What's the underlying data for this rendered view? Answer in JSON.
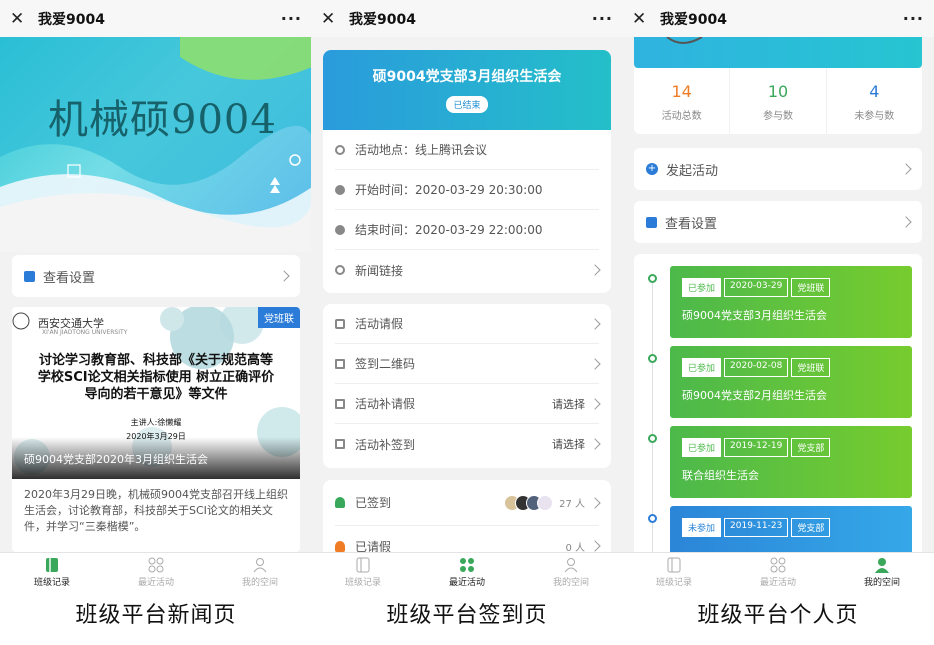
{
  "app_title": "我爱9004",
  "tabs": [
    "班级记录",
    "最近活动",
    "我的空间"
  ],
  "panel1": {
    "hero_title": "机械硕9004",
    "view_settings": "查看设置",
    "news": {
      "tag": "党班联",
      "university": "西安交通大学",
      "university_en": "XI'AN JIAOTONG UNIVERSITY",
      "headline_lines": [
        "讨论学习教育部、科技部《关于规范高等",
        "学校SCI论文相关指标使用 树立正确评价",
        "导向的若干意见》等文件"
      ],
      "speaker": "主讲人:徐懒耀",
      "date": "2020年3月29日",
      "caption": "硕9004党支部2020年3月组织生活会",
      "summary": "2020年3月29日晚，机械硕9004党支部召开线上组织生活会，讨论教育部，科技部关于SCI论文的相关文件，并学习“三秦楷模”。"
    },
    "caption": "班级平台新闻页"
  },
  "panel2": {
    "event_title": "硕9004党支部3月组织生活会",
    "status": "已结束",
    "location_label": "活动地点：",
    "location": "线上腾讯会议",
    "start_label": "开始时间：",
    "start": "2020-03-29 20:30:00",
    "end_label": "结束时间：",
    "end": "2020-03-29 22:00:00",
    "news_link": "新闻链接",
    "menu": [
      {
        "label": "活动请假",
        "option": ""
      },
      {
        "label": "签到二维码",
        "option": ""
      },
      {
        "label": "活动补请假",
        "option": "请选择"
      },
      {
        "label": "活动补签到",
        "option": "请选择"
      }
    ],
    "signed_label": "已签到",
    "signed_count": "27 人",
    "leave_label": "已请假",
    "leave_count": "0 人",
    "caption": "班级平台签到页"
  },
  "panel3": {
    "stats": [
      {
        "num": "14",
        "label": "活动总数",
        "color": "#f07c25"
      },
      {
        "num": "10",
        "label": "参与数",
        "color": "#3aa85a"
      },
      {
        "num": "4",
        "label": "未参与数",
        "color": "#2b7cd9"
      }
    ],
    "launch": "发起活动",
    "view_settings": "查看设置",
    "timeline": [
      {
        "status": "已参加",
        "date": "2020-03-29",
        "org": "党班联",
        "name": "硕9004党支部3月组织生活会"
      },
      {
        "status": "已参加",
        "date": "2020-02-08",
        "org": "党班联",
        "name": "硕9004党支部2月组织生活会"
      },
      {
        "status": "已参加",
        "date": "2019-12-19",
        "org": "党支部",
        "name": "联合组织生活会"
      },
      {
        "status": "未参加",
        "date": "2019-11-23",
        "org": "党支部",
        "name": ""
      }
    ],
    "caption": "班级平台个人页"
  }
}
